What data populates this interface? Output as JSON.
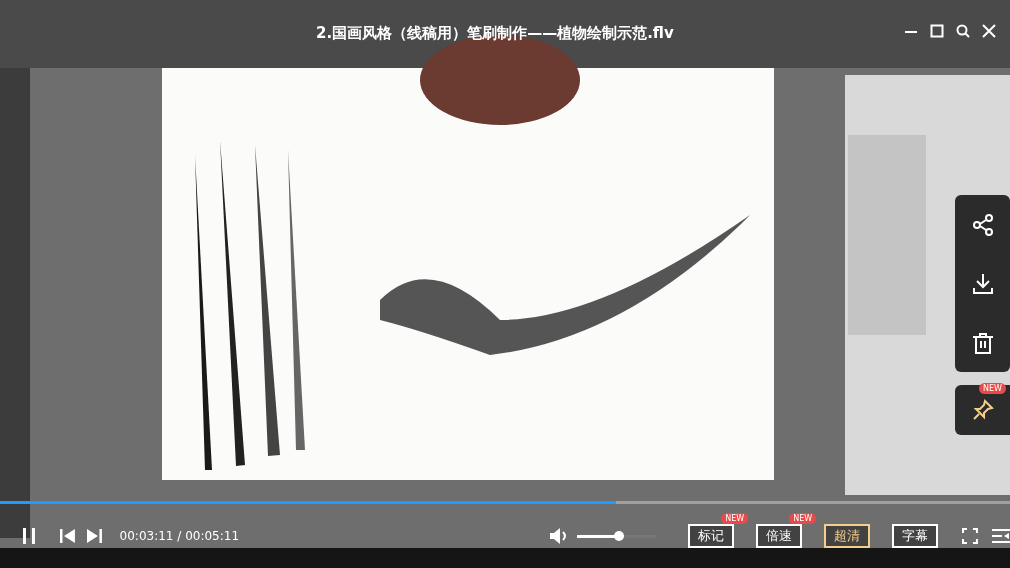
{
  "video": {
    "title": "2.国画风格（线稿用）笔刷制作——植物绘制示范.flv"
  },
  "progress": {
    "level": 0.61
  },
  "controls": {
    "time": "00:03:11 / 00:05:11",
    "volume": {
      "level": 0.53
    },
    "buttons": [
      {
        "label": "标记",
        "badge": "NEW",
        "selected": false
      },
      {
        "label": "倍速",
        "badge": "NEW",
        "selected": false
      },
      {
        "label": "超清",
        "selected": true
      },
      {
        "label": "字幕",
        "selected": false
      }
    ]
  },
  "side_panel": {
    "pin_badge": "NEW"
  }
}
